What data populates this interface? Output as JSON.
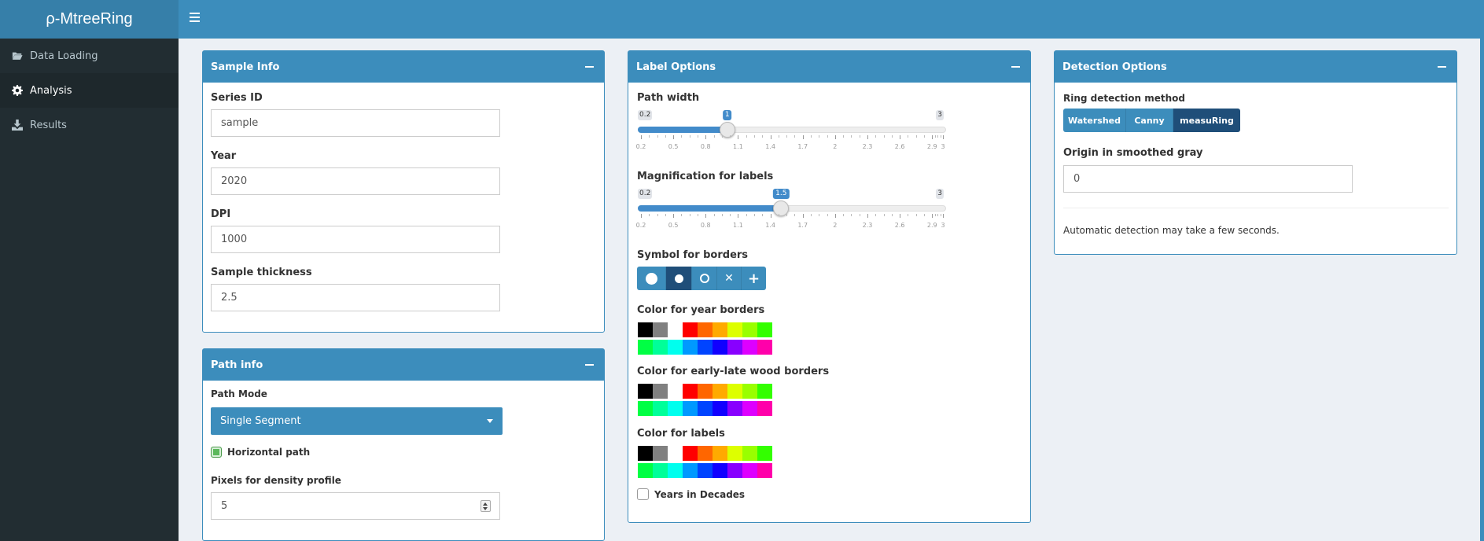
{
  "app": {
    "title": "ρ-MtreeRing"
  },
  "sidebar": {
    "items": [
      {
        "label": "Data Loading",
        "icon": "folder-open-icon"
      },
      {
        "label": "Analysis",
        "icon": "gear-icon",
        "active": true
      },
      {
        "label": "Results",
        "icon": "download-icon"
      }
    ]
  },
  "sample_info": {
    "title": "Sample Info",
    "series_id_label": "Series ID",
    "series_id": "sample",
    "year_label": "Year",
    "year": "2020",
    "dpi_label": "DPI",
    "dpi": "1000",
    "thickness_label": "Sample thickness",
    "thickness": "2.5"
  },
  "path_info": {
    "title": "Path info",
    "mode_label": "Path Mode",
    "mode": "Single Segment",
    "horizontal_label": "Horizontal path",
    "horizontal_checked": true,
    "pixels_label": "Pixels for density profile",
    "pixels": "5"
  },
  "label_options": {
    "title": "Label Options",
    "path_width": {
      "label": "Path width",
      "min": 0.2,
      "max": 3,
      "value": 1,
      "min_text": "0.2",
      "max_text": "3",
      "value_text": "1"
    },
    "magnification": {
      "label": "Magnification for labels",
      "min": 0.2,
      "max": 3,
      "value": 1.5,
      "min_text": "0.2",
      "max_text": "3",
      "value_text": "1.5"
    },
    "ticks": [
      "0.2",
      "0.5",
      "0.8",
      "1.1",
      "1.4",
      "1.7",
      "2",
      "2.3",
      "2.6",
      "2.9",
      "3"
    ],
    "tick_values": [
      0.2,
      0.5,
      0.8,
      1.1,
      1.4,
      1.7,
      2,
      2.3,
      2.6,
      2.9,
      3
    ],
    "symbol_label": "Symbol for borders",
    "symbols": [
      "filled-circle-large-icon",
      "filled-circle-icon",
      "open-circle-icon",
      "cross-icon",
      "plus-icon"
    ],
    "symbol_selected": 1,
    "year_color_label": "Color for year borders",
    "earlylate_color_label": "Color for early-late wood borders",
    "labels_color_label": "Color for labels",
    "palette_row1": [
      "#000000",
      "#808080",
      "#ffffff",
      "#ff0000",
      "#ff6600",
      "#ffaa00",
      "#ddff00",
      "#99ff00",
      "#33ff00"
    ],
    "palette_row2": [
      "#00ff44",
      "#00ff99",
      "#00ffee",
      "#0099ff",
      "#0044ff",
      "#1100ff",
      "#8800ff",
      "#dd00ff",
      "#ff00aa"
    ],
    "decades_label": "Years in Decades"
  },
  "detection": {
    "title": "Detection Options",
    "method_label": "Ring detection method",
    "methods": [
      "Watershed",
      "Canny",
      "measuRing"
    ],
    "method_selected": 2,
    "origin_label": "Origin in smoothed gray",
    "origin": "0",
    "note": "Automatic detection may take a few seconds."
  }
}
